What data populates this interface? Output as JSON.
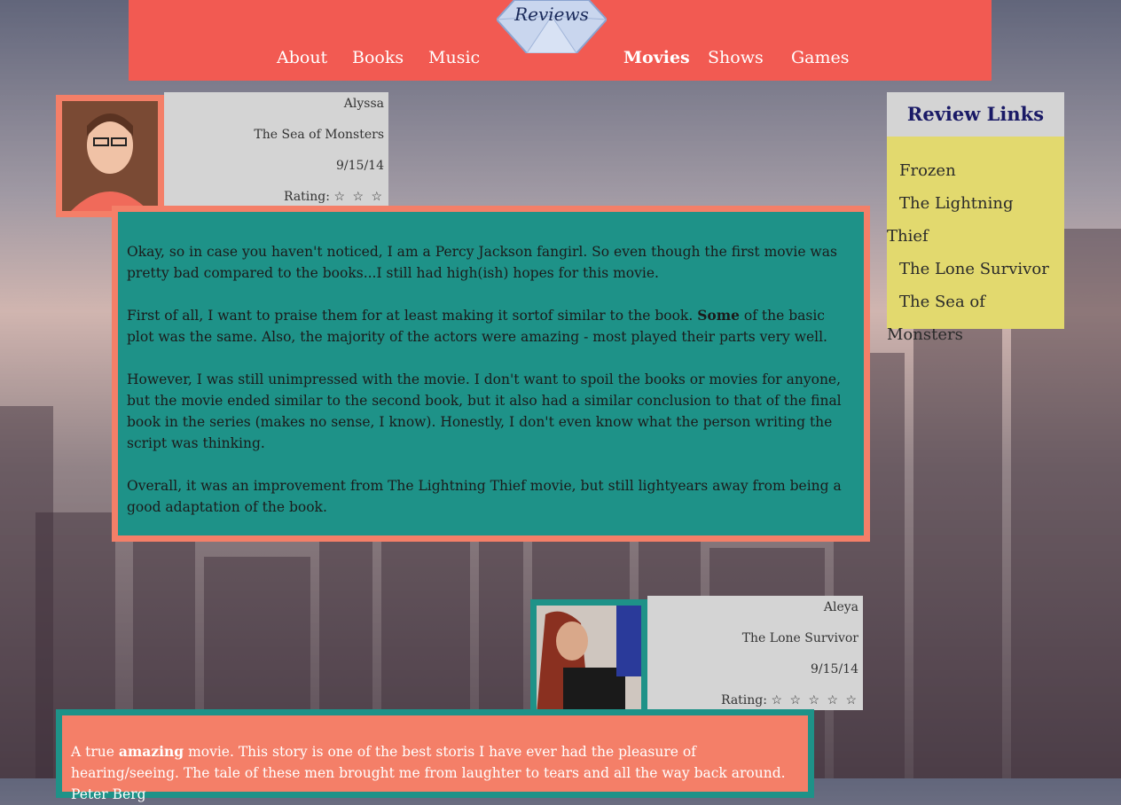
{
  "header": {
    "logo_text": "Reviews",
    "nav": [
      {
        "label": "About",
        "active": false
      },
      {
        "label": "Books",
        "active": false
      },
      {
        "label": "Music",
        "active": false
      },
      {
        "label": "Movies",
        "active": true
      },
      {
        "label": "Shows",
        "active": false
      },
      {
        "label": "Games",
        "active": false
      }
    ]
  },
  "sidebar": {
    "title": "Review Links",
    "links": [
      "Frozen",
      "The Lightning Thief",
      "The Lone Survivor",
      "The Sea of Monsters"
    ]
  },
  "reviews": [
    {
      "author": "Alyssa",
      "title": "The Sea of Monsters",
      "date": "9/15/14",
      "rating_label": "Rating:",
      "rating_stars": "☆ ☆ ☆",
      "rating_value": 3,
      "paragraphs": [
        {
          "before": "Okay, so in case you haven't noticed, I am a Percy Jackson fangirl. So even though the first movie was pretty bad compared to the books...I still had high(ish) hopes for this movie.",
          "bold": "",
          "after": ""
        },
        {
          "before": "First of all, I want to praise them for at least making it sortof similar to the book. ",
          "bold": "Some",
          "after": " of the basic plot was the same. Also, the majority of the actors were amazing - most played their parts very well."
        },
        {
          "before": "However, I was still unimpressed with the movie. I don't want to spoil the books or movies for anyone, but the movie ended similar to the second book, but it also had a similar conclusion to that of the final book in the series (makes no sense, I know). Honestly, I don't even know what the person writing the script was thinking.",
          "bold": "",
          "after": ""
        },
        {
          "before": "Overall, it was an improvement from The Lightning Thief movie, but still lightyears away from being a good adaptation of the book.",
          "bold": "",
          "after": ""
        }
      ]
    },
    {
      "author": "Aleya",
      "title": "The Lone Survivor",
      "date": "9/15/14",
      "rating_label": "Rating:",
      "rating_stars": "☆ ☆ ☆ ☆ ☆",
      "rating_value": 5,
      "paragraphs": [
        {
          "before": "A true ",
          "bold": "amazing",
          "after": " movie. This story is one of the best storis I have ever had the pleasure of hearing/seeing. The tale of these men brought me from laughter to tears and all the way back around. Peter Berg"
        }
      ]
    }
  ],
  "colors": {
    "header_bg": "#f25a52",
    "salmon": "#f47f68",
    "teal": "#1e9288",
    "info_bg": "#d4d4d4",
    "sidebar_bg": "#e2d96e",
    "sidebar_title": "#1a1a66"
  }
}
